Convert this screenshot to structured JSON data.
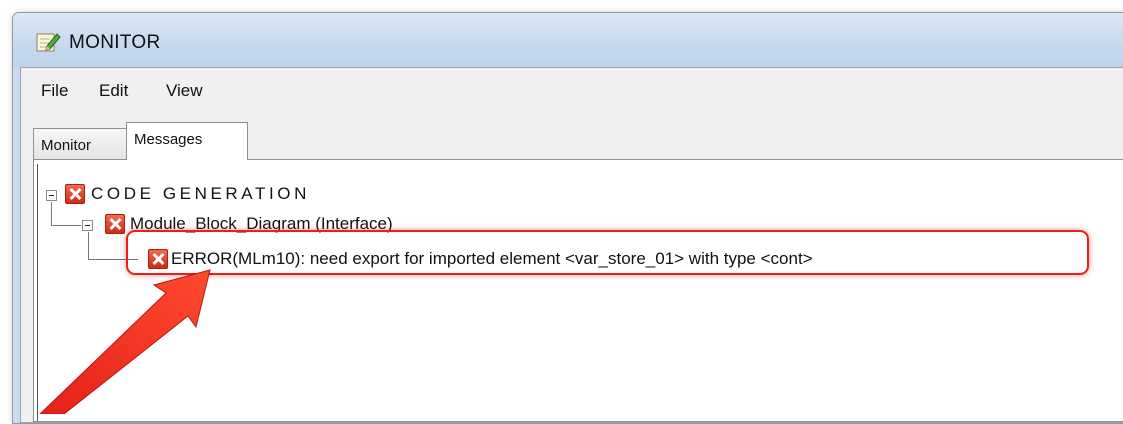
{
  "window": {
    "title": "MONITOR"
  },
  "menu": {
    "items": [
      "File",
      "Edit",
      "View"
    ]
  },
  "tabs": [
    {
      "label": "Monitor",
      "active": false
    },
    {
      "label": "Messages",
      "active": true
    }
  ],
  "tree": {
    "root": {
      "label": "CODE GENERATION",
      "icon": "error-icon",
      "expanded": true
    },
    "child": {
      "label": "Module_Block_Diagram (Interface)",
      "icon": "error-icon",
      "expanded": true
    },
    "message": {
      "label": "ERROR(MLm10): need export for imported element <var_store_01> with type <cont>",
      "icon": "error-icon"
    }
  },
  "colors": {
    "highlight": "#e8201a",
    "error_icon": "#d9321b",
    "titlebar": "#c5d9ee"
  }
}
